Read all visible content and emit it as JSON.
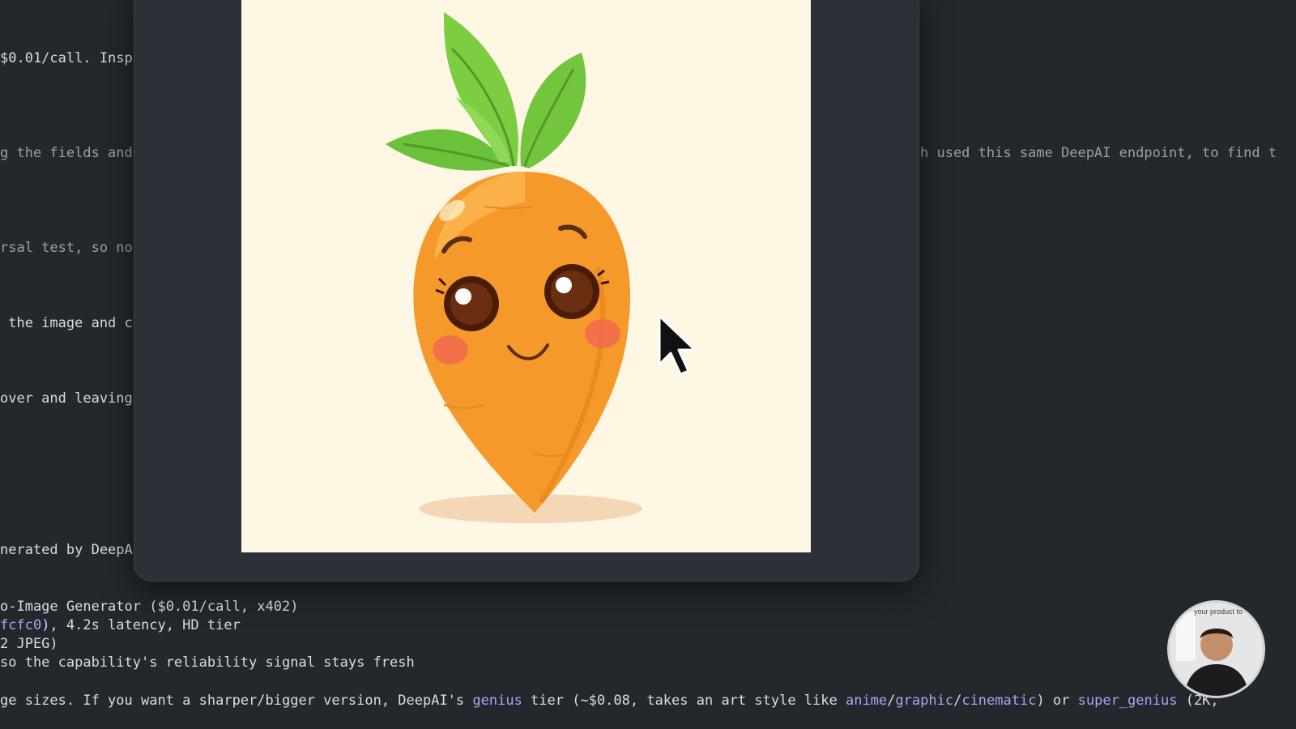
{
  "terminal": {
    "left_fragments": [
      "$0.01/call. Insp",
      "g the fields and",
      "rsal test, so no",
      " the image and c",
      "over and leaving",
      "nerated by DeepA"
    ],
    "right_fragment": "h used this same DeepAI endpoint, to find t",
    "bottom_lines": {
      "line1": "o-Image Generator ($0.01/call, x402)",
      "line2_hl": "fcfc0",
      "line2_rest": "), 4.2s latency, HD tier",
      "line3": "2 JPEG)",
      "line4": "so the capability's reliability signal stays fresh",
      "line5_a": "ge sizes. If you want a sharper/bigger version, DeepAI's ",
      "line5_genius": "genius",
      "line5_b": " tier (~$0.08, takes an art style like ",
      "line5_anime": "anime",
      "line5_slash1": "/",
      "line5_graphic": "graphic",
      "line5_slash2": "/",
      "line5_cinematic": "cinematic",
      "line5_c": ") or ",
      "line5_super": "super_genius",
      "line5_d": " (2K,"
    }
  },
  "image_viewer": {
    "subject_icon": "carrot-character-illustration",
    "background_color": "#fdf7e4"
  },
  "cursor": {
    "icon": "mouse-pointer-icon"
  },
  "webcam": {
    "overlay_text": "your product to"
  },
  "colors": {
    "terminal_bg": "#23282d",
    "terminal_text": "#d6dde3",
    "highlight": "#a8a6f4",
    "modal_bg": "#2b3136"
  }
}
